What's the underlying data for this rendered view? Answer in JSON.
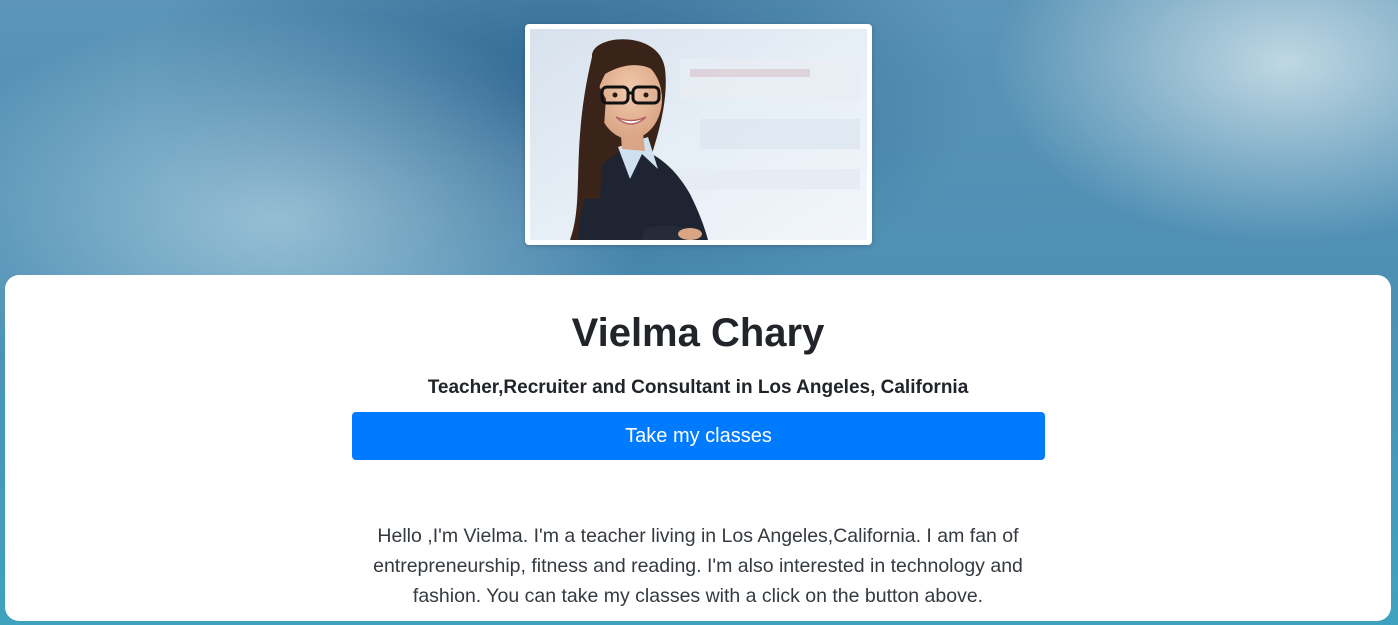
{
  "profile": {
    "photo_alt": "Portrait of a smiling woman with glasses in a dark blazer",
    "name": "Vielma Chary",
    "subtitle": "Teacher,Recruiter and Consultant in Los Angeles, California",
    "cta_label": "Take my classes",
    "bio": "Hello ,I'm Vielma. I'm a teacher living in Los Angeles,California. I am fan of entrepreneurship, fitness and reading. I'm also interested in technology and fashion. You can take my classes with a click on the button above."
  },
  "colors": {
    "primary_button": "#007bff",
    "text_dark": "#212529",
    "background_blue": "#4e8fb4"
  }
}
